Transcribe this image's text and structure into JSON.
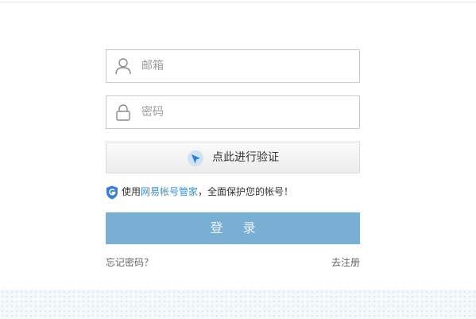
{
  "form": {
    "email_placeholder": "邮箱",
    "password_placeholder": "密码",
    "verify_label": "点此进行验证",
    "notice": {
      "prefix": "使用",
      "link": "网易帐号管家",
      "suffix": "，全面保护您的帐号！"
    },
    "login_label": "登 录",
    "forgot_label": "忘记密码？",
    "register_label": "去注册"
  },
  "icons": {
    "email": "user-icon",
    "password": "lock-icon",
    "verify": "cursor-pointer-icon",
    "notice": "shield-g-icon"
  },
  "colors": {
    "login_button": "#7aafd4",
    "link": "#3a8ed3",
    "shield": "#3a7fd0"
  }
}
